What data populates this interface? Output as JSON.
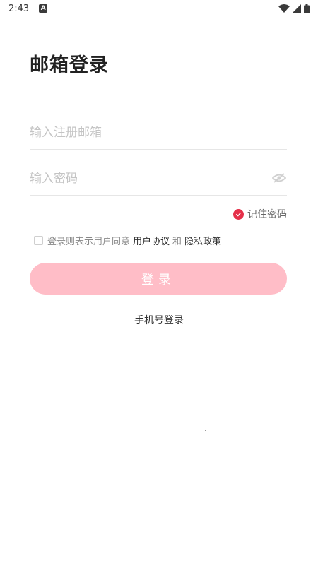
{
  "status_bar": {
    "time": "2:43",
    "notification_icon_letter": "A",
    "icons": [
      "wifi-icon",
      "signal-icon",
      "battery-icon"
    ]
  },
  "page": {
    "title": "邮箱登录"
  },
  "form": {
    "email_placeholder": "输入注册邮箱",
    "email_value": "",
    "password_placeholder": "输入密码",
    "password_value": "",
    "remember_label": "记住密码",
    "remember_checked": true,
    "agreement": {
      "prefix": "登录则表示用户同意",
      "user_agreement": "用户协议",
      "connector": "和",
      "privacy_policy": "隐私政策",
      "checked": false
    },
    "login_button": "登录",
    "alt_login": "手机号登录"
  },
  "colors": {
    "accent": "#e5304a",
    "login_button_bg": "#ffbdc7",
    "placeholder": "#c4c4c4",
    "divider": "#e6e6e6"
  }
}
